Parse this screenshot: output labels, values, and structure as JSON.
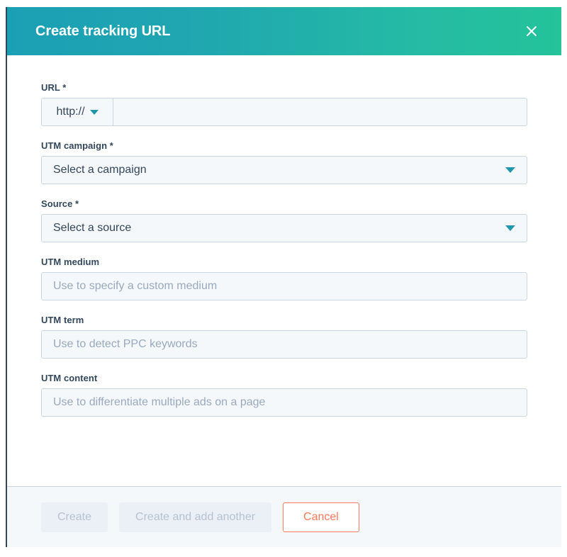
{
  "modal": {
    "title": "Create tracking URL",
    "close_icon": "close-icon"
  },
  "form": {
    "url": {
      "label": "URL *",
      "prefix_value": "http://",
      "prefix_caret_icon": "chevron-down-icon",
      "value": "",
      "placeholder": ""
    },
    "campaign": {
      "label": "UTM campaign *",
      "value": "Select a campaign",
      "caret_icon": "chevron-down-icon"
    },
    "source": {
      "label": "Source *",
      "value": "Select a source",
      "caret_icon": "chevron-down-icon"
    },
    "medium": {
      "label": "UTM medium",
      "value": "",
      "placeholder": "Use to specify a custom medium"
    },
    "term": {
      "label": "UTM term",
      "value": "",
      "placeholder": "Use to detect PPC keywords"
    },
    "content": {
      "label": "UTM content",
      "value": "",
      "placeholder": "Use to differentiate multiple ads on a page"
    }
  },
  "footer": {
    "create_label": "Create",
    "create_add_another_label": "Create and add another",
    "cancel_label": "Cancel"
  },
  "colors": {
    "header_gradient_start": "#1b9fb5",
    "header_gradient_end": "#24c39a",
    "accent_teal": "#2196ad",
    "cancel_orange": "#ff7a59",
    "label_navy": "#33475b",
    "field_bg": "#f5f8fa",
    "field_border": "#cbd6e2",
    "placeholder": "#99a9be",
    "disabled_bg": "#eaf0f6",
    "disabled_text": "#b6c2d0"
  }
}
